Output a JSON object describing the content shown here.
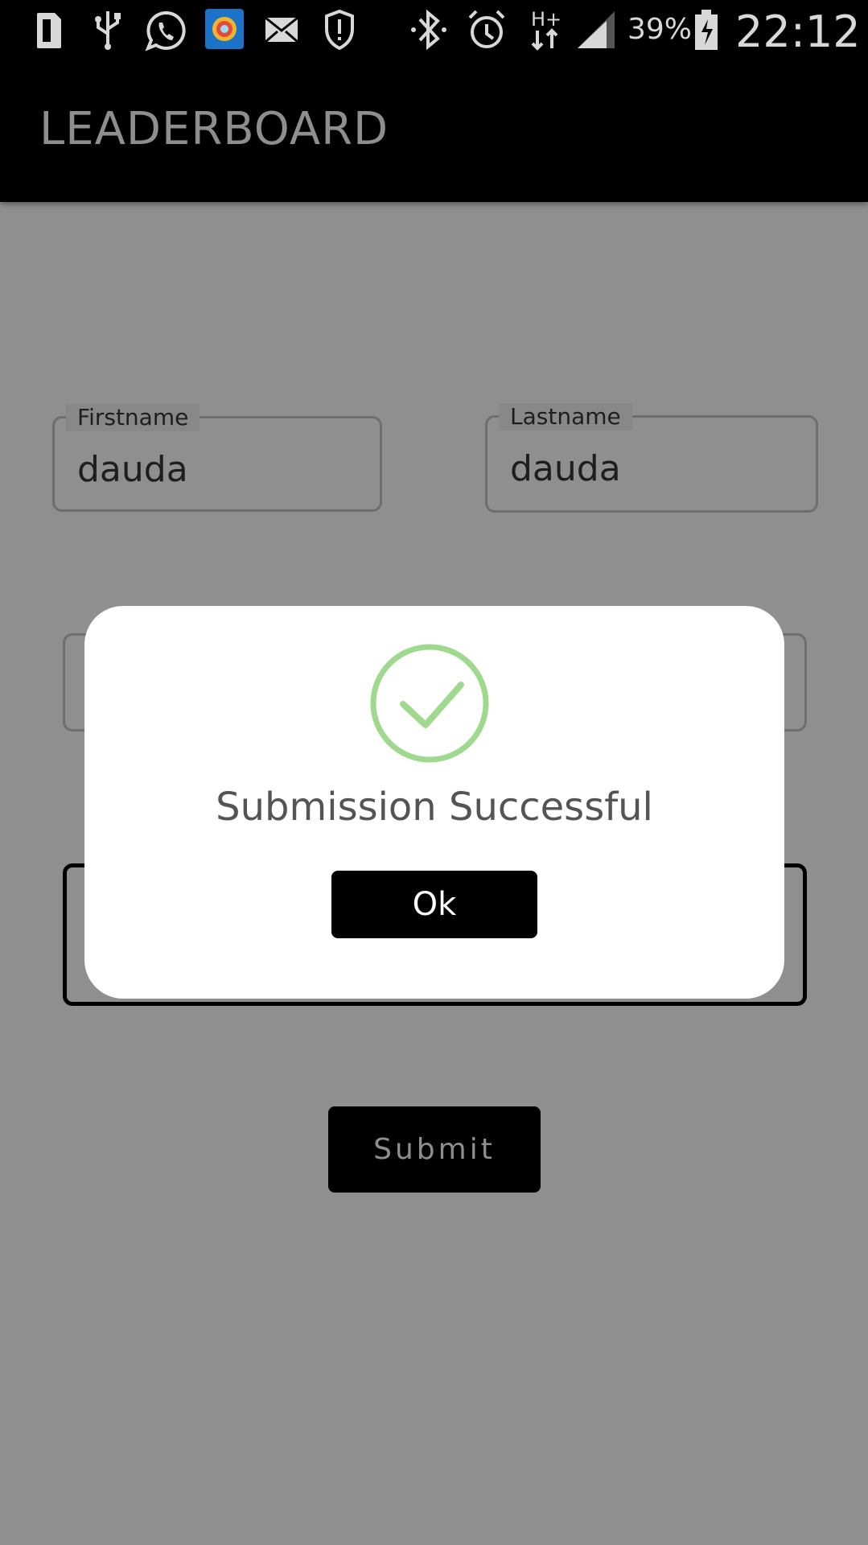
{
  "status_bar": {
    "icons": [
      "sim-icon",
      "usb-icon",
      "whatsapp-icon",
      "app-icon",
      "mail-icon",
      "shield-alert-icon",
      "bluetooth-icon",
      "alarm-icon",
      "hplus-data-icon",
      "signal-icon",
      "battery-icon"
    ],
    "battery": "39%",
    "time": "22:12"
  },
  "app_bar": {
    "title": "LEADERBOARD"
  },
  "form": {
    "firstname_label": "Firstname",
    "firstname_value": "dauda",
    "lastname_label": "Lastname",
    "lastname_value": "dauda",
    "submit_label": "Submit"
  },
  "dialog": {
    "title": "Submission Successful",
    "ok_label": "Ok",
    "accent_color": "#9fd98e"
  },
  "colors": {
    "scrim": "#8f8f8f",
    "bar": "#000000"
  }
}
